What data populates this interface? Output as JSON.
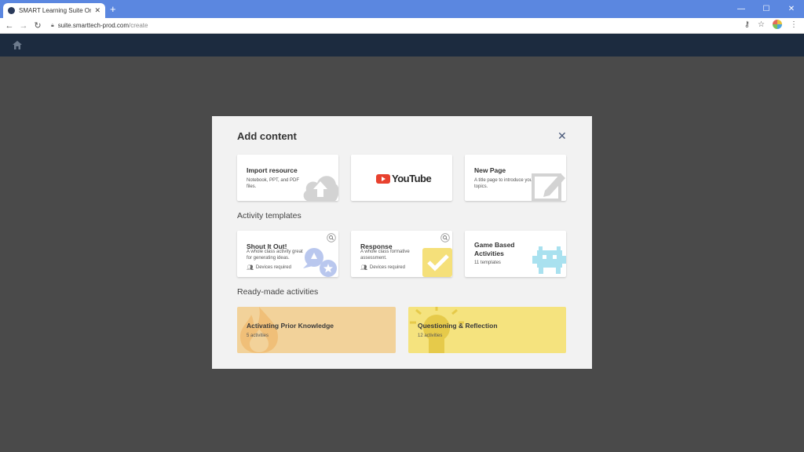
{
  "browser": {
    "tab_title": "SMART Learning Suite Online",
    "tab_close": "✕",
    "new_tab": "+",
    "url_host": "suite.smarttech-prod.com",
    "url_path": "/create",
    "controls": {
      "minimize": "—",
      "maximize": "☐",
      "close": "✕"
    }
  },
  "colors": {
    "titlebar": "#5b87e0",
    "app_header": "#1c2b3f",
    "overlay": "#4a4a4a",
    "youtube_red": "#e8412e",
    "prior_knowledge_bg": "#f2d29a",
    "questioning_bg": "#f5e37e"
  },
  "modal": {
    "title": "Add content",
    "close_icon": "close-icon",
    "content_cards": [
      {
        "title": "Import resource",
        "description": "Notebook, PPT, and PDF files.",
        "icon": "cloud-upload-icon"
      },
      {
        "title": "YouTube",
        "icon": "youtube-logo"
      },
      {
        "title": "New Page",
        "description": "A title page to introduce your topics.",
        "icon": "edit-page-icon"
      }
    ],
    "activity_section_title": "Activity templates",
    "activity_cards": [
      {
        "title": "Shout It Out!",
        "description": "A whole class activity great for generating ideas.",
        "devices": "Devices required",
        "icon": "speech-bubbles-icon"
      },
      {
        "title": "Response",
        "description": "A whole class formative assessment.",
        "devices": "Devices required",
        "icon": "checkmark-icon"
      },
      {
        "title": "Game Based Activities",
        "count": "11 templates",
        "icon": "space-invader-icon"
      }
    ],
    "ready_section_title": "Ready-made activities",
    "ready_cards": [
      {
        "title": "Activating Prior Knowledge",
        "count": "5 activities",
        "icon": "flame-icon"
      },
      {
        "title": "Questioning & Reflection",
        "count": "12 activities",
        "icon": "lightbulb-icon"
      }
    ]
  }
}
